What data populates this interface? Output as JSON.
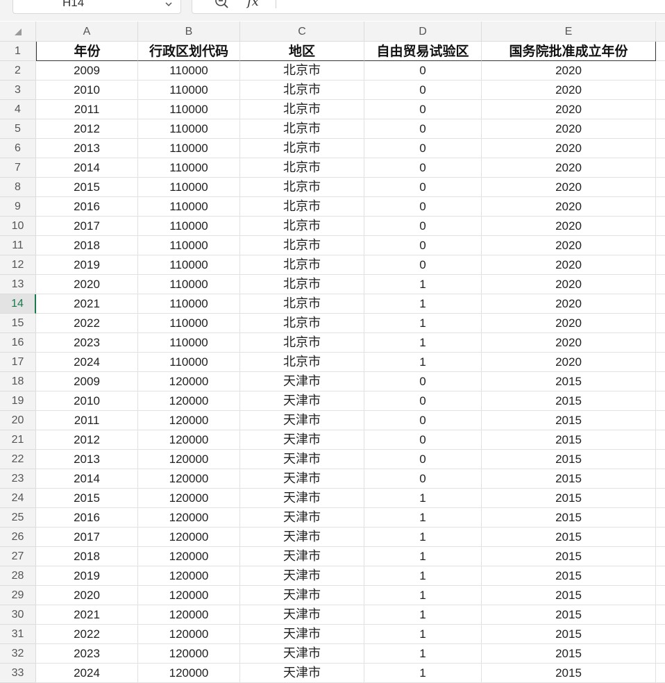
{
  "formula_bar": {
    "cell_ref": "H14",
    "fx_label": "fx"
  },
  "columns": [
    "A",
    "B",
    "C",
    "D",
    "E"
  ],
  "header": [
    "年份",
    "行政区划代码",
    "地区",
    "自由贸易试验区",
    "国务院批准成立年份"
  ],
  "active_row": 14,
  "rows": [
    [
      "2009",
      "110000",
      "北京市",
      "0",
      "2020"
    ],
    [
      "2010",
      "110000",
      "北京市",
      "0",
      "2020"
    ],
    [
      "2011",
      "110000",
      "北京市",
      "0",
      "2020"
    ],
    [
      "2012",
      "110000",
      "北京市",
      "0",
      "2020"
    ],
    [
      "2013",
      "110000",
      "北京市",
      "0",
      "2020"
    ],
    [
      "2014",
      "110000",
      "北京市",
      "0",
      "2020"
    ],
    [
      "2015",
      "110000",
      "北京市",
      "0",
      "2020"
    ],
    [
      "2016",
      "110000",
      "北京市",
      "0",
      "2020"
    ],
    [
      "2017",
      "110000",
      "北京市",
      "0",
      "2020"
    ],
    [
      "2018",
      "110000",
      "北京市",
      "0",
      "2020"
    ],
    [
      "2019",
      "110000",
      "北京市",
      "0",
      "2020"
    ],
    [
      "2020",
      "110000",
      "北京市",
      "1",
      "2020"
    ],
    [
      "2021",
      "110000",
      "北京市",
      "1",
      "2020"
    ],
    [
      "2022",
      "110000",
      "北京市",
      "1",
      "2020"
    ],
    [
      "2023",
      "110000",
      "北京市",
      "1",
      "2020"
    ],
    [
      "2024",
      "110000",
      "北京市",
      "1",
      "2020"
    ],
    [
      "2009",
      "120000",
      "天津市",
      "0",
      "2015"
    ],
    [
      "2010",
      "120000",
      "天津市",
      "0",
      "2015"
    ],
    [
      "2011",
      "120000",
      "天津市",
      "0",
      "2015"
    ],
    [
      "2012",
      "120000",
      "天津市",
      "0",
      "2015"
    ],
    [
      "2013",
      "120000",
      "天津市",
      "0",
      "2015"
    ],
    [
      "2014",
      "120000",
      "天津市",
      "0",
      "2015"
    ],
    [
      "2015",
      "120000",
      "天津市",
      "1",
      "2015"
    ],
    [
      "2016",
      "120000",
      "天津市",
      "1",
      "2015"
    ],
    [
      "2017",
      "120000",
      "天津市",
      "1",
      "2015"
    ],
    [
      "2018",
      "120000",
      "天津市",
      "1",
      "2015"
    ],
    [
      "2019",
      "120000",
      "天津市",
      "1",
      "2015"
    ],
    [
      "2020",
      "120000",
      "天津市",
      "1",
      "2015"
    ],
    [
      "2021",
      "120000",
      "天津市",
      "1",
      "2015"
    ],
    [
      "2022",
      "120000",
      "天津市",
      "1",
      "2015"
    ],
    [
      "2023",
      "120000",
      "天津市",
      "1",
      "2015"
    ],
    [
      "2024",
      "120000",
      "天津市",
      "1",
      "2015"
    ]
  ],
  "colors": {
    "active_accent": "#1a7a4c",
    "header_bg": "#f3f3f3",
    "grid_line": "#e1e1e1"
  }
}
